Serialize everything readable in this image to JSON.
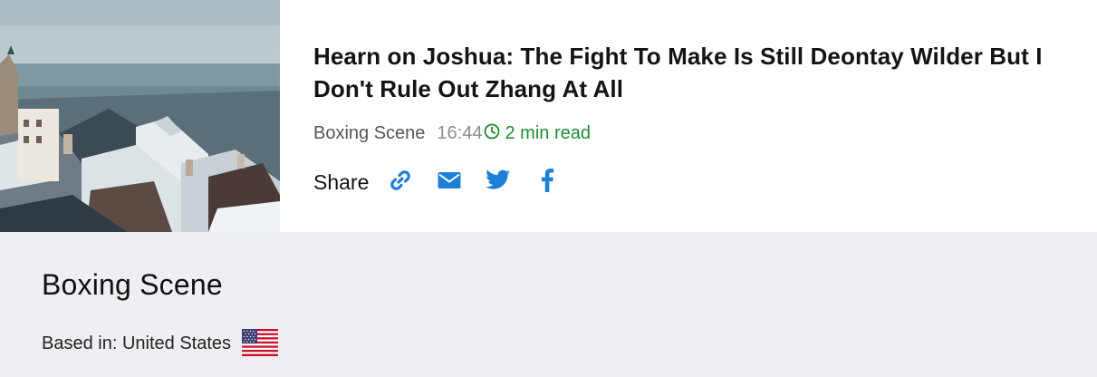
{
  "article": {
    "headline": "Hearn on Joshua: The Fight To Make Is Still Deontay Wilder But I Don't Rule Out Zhang At All",
    "source": "Boxing Scene",
    "time": "16:44",
    "read_time": "2 min read"
  },
  "share": {
    "label": "Share",
    "buttons": [
      {
        "icon": "link-icon"
      },
      {
        "icon": "envelope-icon"
      },
      {
        "icon": "twitter-icon"
      },
      {
        "icon": "facebook-icon"
      }
    ]
  },
  "source_info": {
    "name": "Boxing Scene",
    "based_in": "Based in: United States",
    "flag": "united-states-flag-icon"
  },
  "colors": {
    "accent_blue": "#1e7fd6",
    "read_time_green": "#1f8a34",
    "footer_bg": "#f0eef3"
  }
}
